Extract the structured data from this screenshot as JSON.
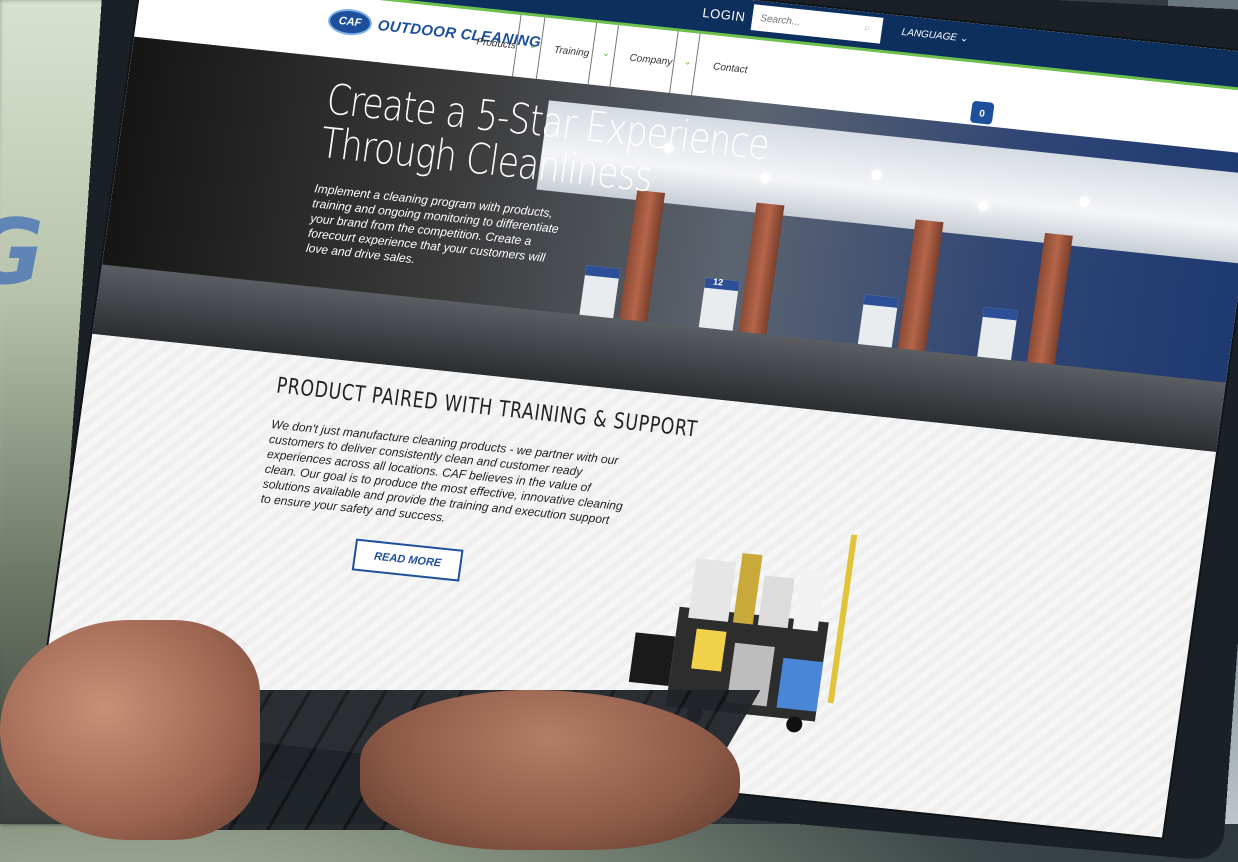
{
  "topbar": {
    "login": "LOGIN",
    "search_placeholder": "Search...",
    "language": "LANGUAGE ⌄"
  },
  "logo": {
    "badge": "CAF",
    "text": "OUTDOOR CLEANING"
  },
  "nav": {
    "items": [
      "Products",
      "Training",
      "Company",
      "Contact"
    ]
  },
  "cart": {
    "count": "0"
  },
  "hero": {
    "title_line1": "Create a 5-Star Experience",
    "title_line2": "Through Cleanliness",
    "subtitle": "Implement a cleaning program with products, training and ongoing monitoring to differentiate your brand from the competition. Create a forecourt experience that your customers will love and drive sales.",
    "pump_number": "12"
  },
  "section": {
    "title": "PRODUCT PAIRED WITH TRAINING & SUPPORT",
    "body": "We don't just manufacture cleaning products - we partner with our customers to deliver consistently clean and customer ready experiences across all locations. CAF believes in the value of clean. Our goal is to produce the most effective, innovative cleaning solutions available and provide the training and execution support to ensure your safety and success.",
    "read_more": "READ MORE"
  },
  "colors": {
    "navy": "#0d2f5e",
    "accent_green": "#6cc24a",
    "brand_blue": "#1d4f9c"
  }
}
